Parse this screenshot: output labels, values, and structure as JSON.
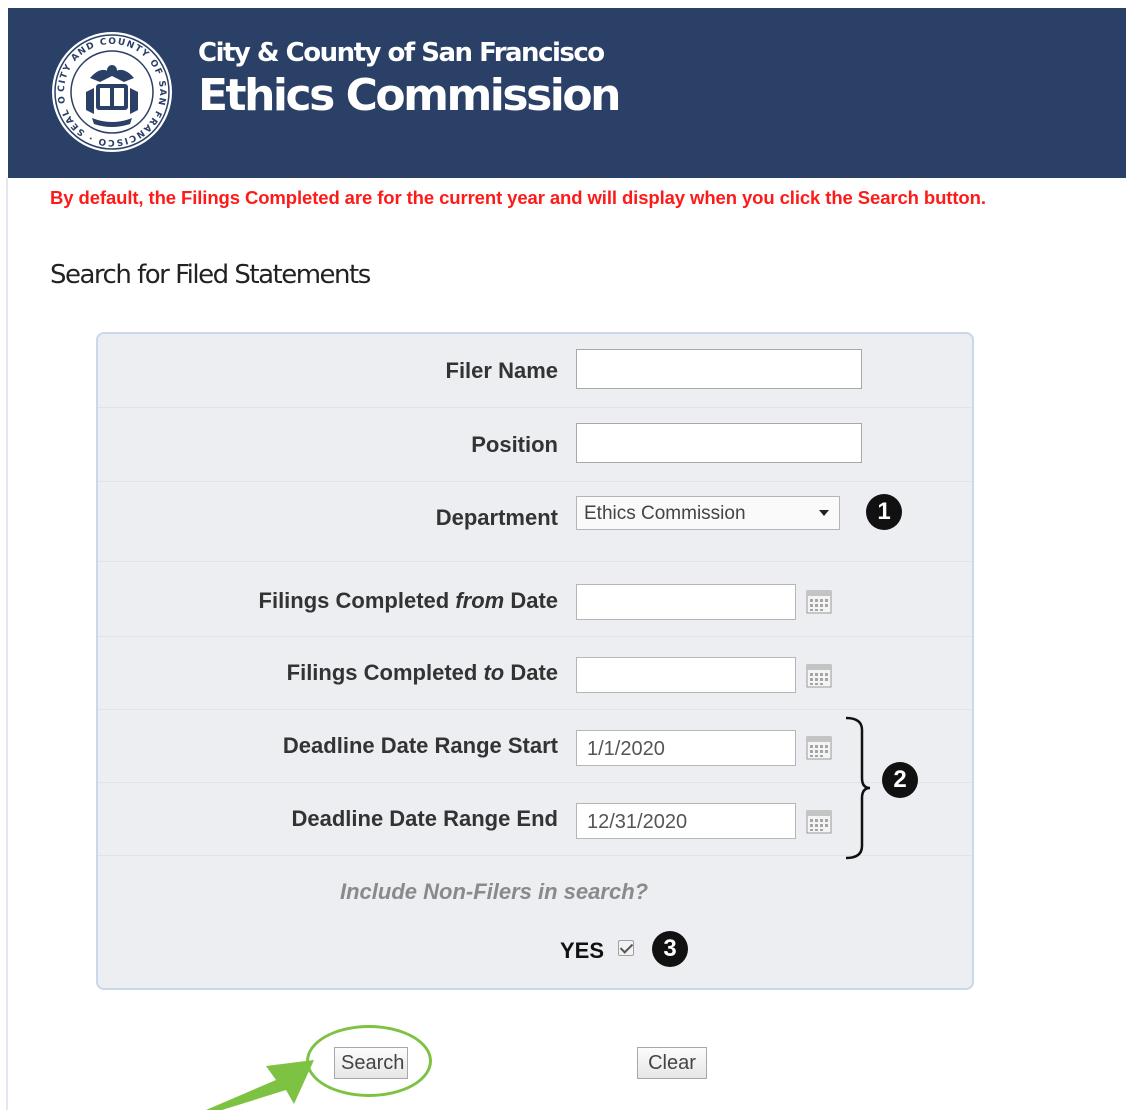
{
  "header": {
    "org_name": "City & County of San Francisco",
    "title": "Ethics Commission",
    "seal_text": "CITY AND COUNTY OF SAN FRANCISCO · SEAL OF THE"
  },
  "notice": "By default, the Filings Completed are for the current year and will display when you click the Search button.",
  "page_title": "Search for Filed Statements",
  "form": {
    "filer_name": {
      "label": "Filer Name",
      "value": ""
    },
    "position": {
      "label": "Position",
      "value": ""
    },
    "department": {
      "label": "Department",
      "value": "Ethics Commission"
    },
    "from_date": {
      "label_pre": "Filings Completed ",
      "label_em": "from",
      "label_post": " Date",
      "value": ""
    },
    "to_date": {
      "label_pre": "Filings Completed ",
      "label_em": "to",
      "label_post": " Date",
      "value": ""
    },
    "deadline_start": {
      "label": "Deadline Date Range Start",
      "value": "1/1/2020"
    },
    "deadline_end": {
      "label": "Deadline Date Range End",
      "value": "12/31/2020"
    },
    "nonfilers_question": "Include Non-Filers in search?",
    "yes_label": "YES",
    "yes_checked": true
  },
  "markers": {
    "one": "1",
    "two": "2",
    "three": "3"
  },
  "buttons": {
    "search": "Search",
    "clear": "Clear"
  },
  "colors": {
    "header_bg": "#2b4066",
    "notice": "#ff1a1a",
    "panel_bg": "#eceef1",
    "panel_border": "#c9d8ea",
    "highlight": "#7dc242"
  },
  "icons": {
    "calendar": "calendar-icon",
    "seal": "city-seal-icon",
    "dropdown": "chevron-down-icon"
  }
}
